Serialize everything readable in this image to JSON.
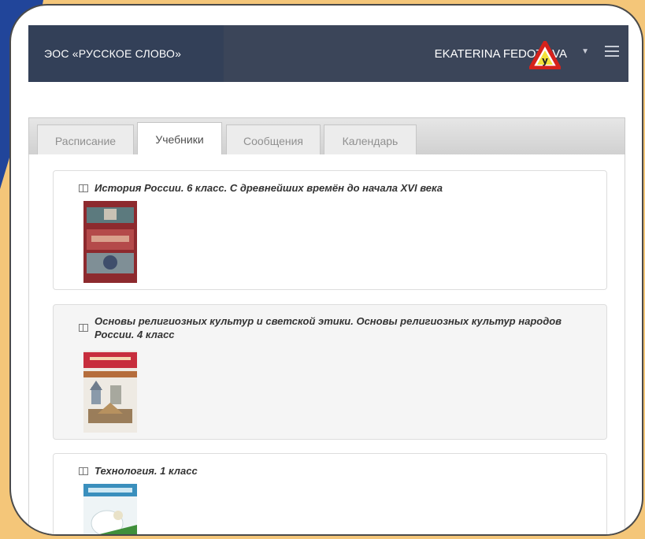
{
  "navbar": {
    "brand": "ЭОС «РУССКОЕ СЛОВО»",
    "user_name": "EKATERINA FEDOTOVA",
    "icons": [
      "warning-road-sign-icon",
      "caret-down-icon",
      "hamburger-menu-icon"
    ]
  },
  "tabs": [
    {
      "label": "Расписание"
    },
    {
      "label": "Учебники",
      "active": true
    },
    {
      "label": "Сообщения"
    },
    {
      "label": "Календарь"
    }
  ],
  "books": [
    {
      "title": "История России. 6 класс. С древнейших времён до начала XVI века",
      "icon": "book-icon"
    },
    {
      "title": "Основы религиозных культур и светской этики. Основы религиозных культур народов России. 4 класс",
      "icon": "book-icon"
    },
    {
      "title": "Технология. 1 класс",
      "icon": "book-icon"
    }
  ],
  "colors": {
    "navbar": "#3b4559",
    "background": "#f4c679",
    "accent_blue": "#21459a",
    "warning_red": "#d6221b"
  }
}
